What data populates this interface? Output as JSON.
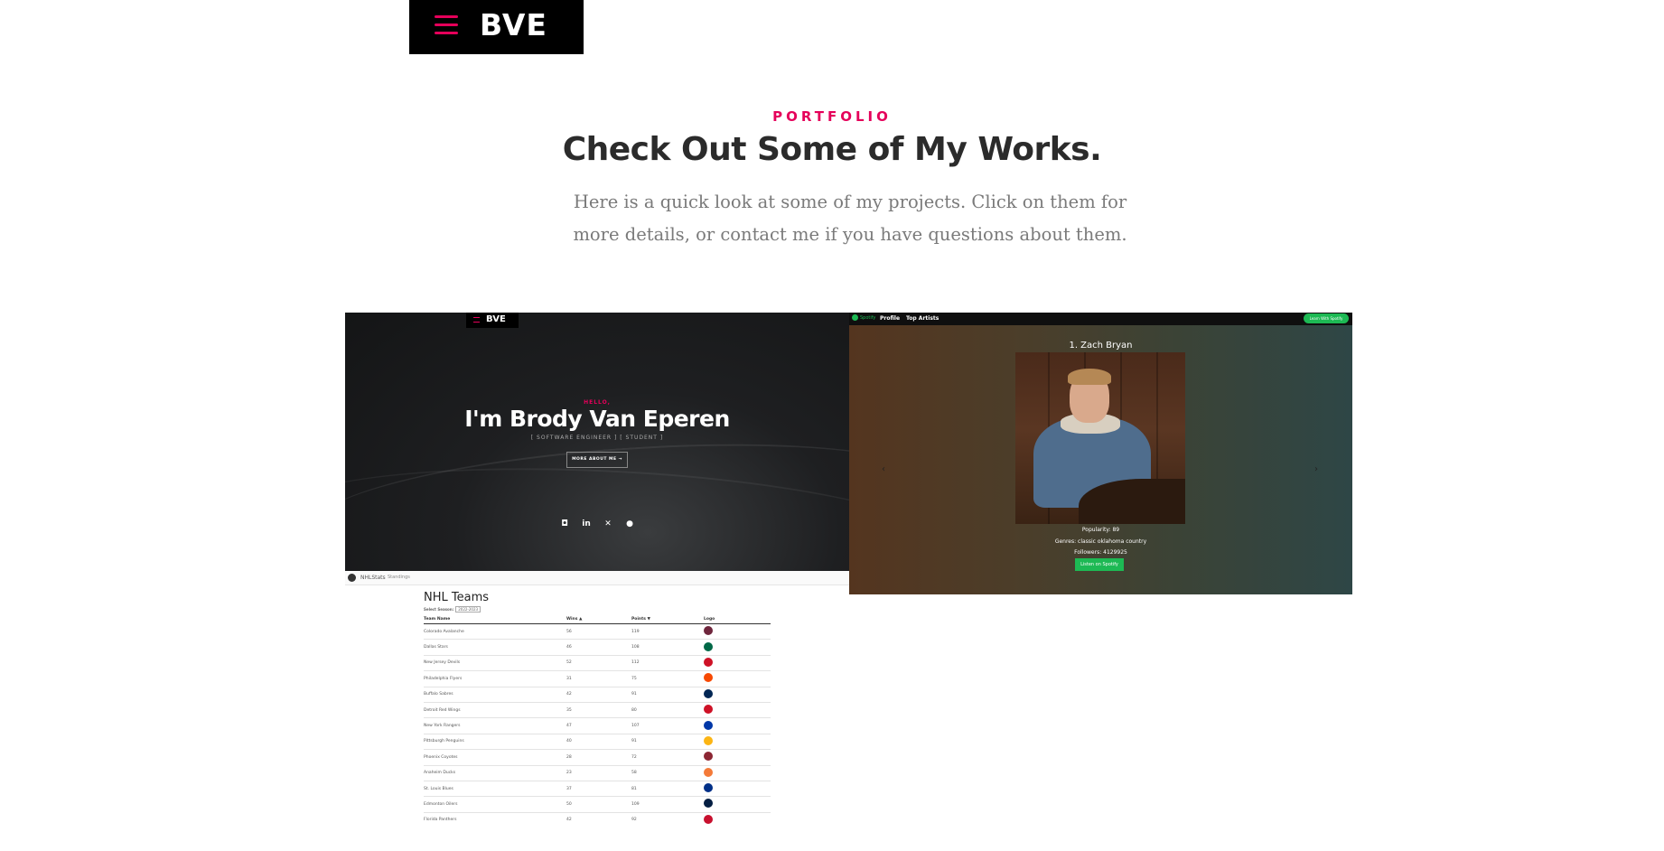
{
  "header": {
    "brand": "BVE"
  },
  "portfolio": {
    "eyebrow": "PORTFOLIO",
    "title": "Check Out Some of My Works.",
    "intro": "Here is a quick look at some of my projects. Click on them for more details, or contact me if you have questions about them."
  },
  "projects": {
    "personal_site": {
      "brand": "BVE",
      "hello": "HELLO,",
      "name": "I'm Brody Van Eperen",
      "roles": "[ SOFTWARE ENGINEER ] [ STUDENT ]",
      "button": "MORE ABOUT ME →",
      "socials": [
        "instagram-icon",
        "linkedin-icon",
        "twitter-icon",
        "github-icon"
      ]
    },
    "spotify_app": {
      "logo": "Spotify",
      "nav": [
        "Profile",
        "Top Artists"
      ],
      "top_button": "Learn With Spotify",
      "artist": "1. Zach Bryan",
      "popularity": "Popularity: 89",
      "genres": "Genres: classic oklahoma country",
      "followers": "Followers: 4129925",
      "listen": "Listen on Spotify",
      "prev": "‹",
      "next": "›"
    },
    "nhl_stats": {
      "brand": "NHLStats",
      "nav_link": "Standings",
      "heading": "NHL Teams",
      "season_label": "Select Season:",
      "season_value": "2022-2023",
      "columns": [
        "Team Name",
        "Wins ▲",
        "Points ▼",
        "Logo"
      ],
      "rows": [
        [
          "Colorado Avalanche",
          "56",
          "119",
          "#6f263d"
        ],
        [
          "Dallas Stars",
          "46",
          "108",
          "#006847"
        ],
        [
          "New Jersey Devils",
          "52",
          "112",
          "#ce1126"
        ],
        [
          "Philadelphia Flyers",
          "31",
          "75",
          "#f74902"
        ],
        [
          "Buffalo Sabres",
          "42",
          "91",
          "#002654"
        ],
        [
          "Detroit Red Wings",
          "35",
          "80",
          "#ce1126"
        ],
        [
          "New York Rangers",
          "47",
          "107",
          "#0038a8"
        ],
        [
          "Pittsburgh Penguins",
          "40",
          "91",
          "#fcb514"
        ],
        [
          "Phoenix Coyotes",
          "28",
          "72",
          "#8c2633"
        ],
        [
          "Anaheim Ducks",
          "23",
          "58",
          "#f47a38"
        ],
        [
          "St. Louis Blues",
          "37",
          "81",
          "#002f87"
        ],
        [
          "Edmonton Oilers",
          "50",
          "109",
          "#041e42"
        ],
        [
          "Florida Panthers",
          "42",
          "92",
          "#c8102e"
        ]
      ]
    }
  },
  "colors": {
    "accent": "#e5005a",
    "spotify_green": "#1db954"
  }
}
